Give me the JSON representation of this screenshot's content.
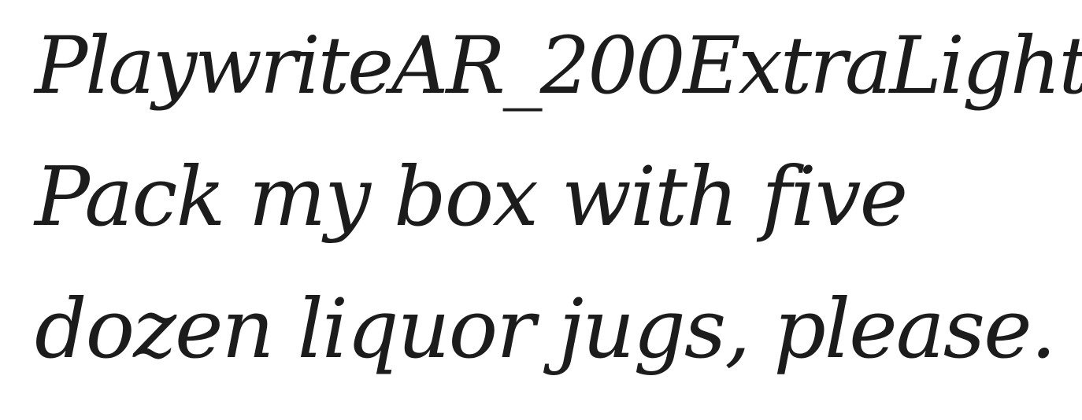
{
  "specimen": {
    "font_name": "PlaywriteAR_200ExtraLight",
    "pangram_line_1": "Pack my box with five",
    "pangram_line_2": "dozen liquor jugs, please."
  },
  "colors": {
    "background": "#ffffff",
    "text": "#1c1c1c"
  }
}
